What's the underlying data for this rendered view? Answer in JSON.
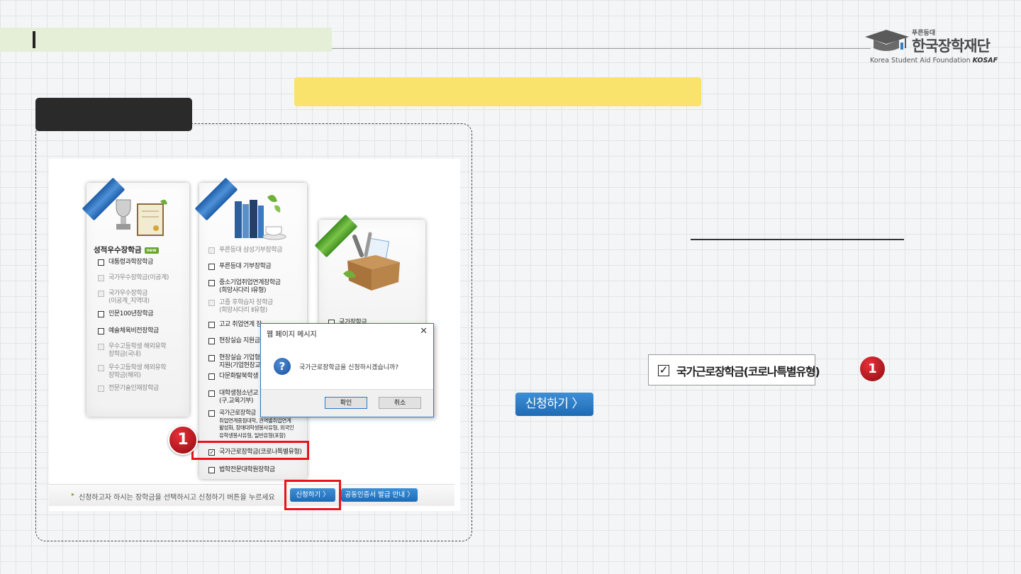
{
  "logo": {
    "small_text": "푸른등대",
    "main_text": "한국장학재단",
    "english_text": "Korea Student Aid Foundation",
    "english_abbr": "KOSAF"
  },
  "cards": {
    "card1": {
      "title": "성적우수장학금",
      "badge": "new",
      "items": [
        {
          "label": "대통령과학장학금",
          "enabled": true,
          "checked": false
        },
        {
          "label": "국가우수장학금(이공계)",
          "enabled": false,
          "checked": false
        },
        {
          "label": "국가우수장학금",
          "label2": "(이공계_지역대)",
          "enabled": false,
          "checked": false
        },
        {
          "label": "인문100년장학금",
          "enabled": true,
          "checked": false
        },
        {
          "label": "예술체육비전장학금",
          "enabled": true,
          "checked": false
        },
        {
          "label": "우수고등학생 해외유학",
          "label2": "장학금(국내)",
          "enabled": false,
          "checked": false
        },
        {
          "label": "우수고등학생 해외유학",
          "label2": "장학금(해외)",
          "enabled": false,
          "checked": false
        },
        {
          "label": "전문기술인재장학금",
          "enabled": false,
          "checked": false
        }
      ]
    },
    "card2": {
      "items": [
        {
          "label": "푸른등대 삼성기부장학금",
          "enabled": false,
          "checked": false
        },
        {
          "label": "푸른등대 기부장학금",
          "enabled": true,
          "checked": false
        },
        {
          "label": "중소기업취업연계장학금",
          "label2": "(희망사다리 Ⅰ유형)",
          "enabled": true,
          "checked": false
        },
        {
          "label": "고졸 후학습자 장학금",
          "label2": "(희망사다리 Ⅱ유형)",
          "enabled": false,
          "checked": false
        },
        {
          "label": "고교 취업연계 장",
          "enabled": true,
          "checked": false
        },
        {
          "label": "현장실습 지원금",
          "enabled": true,
          "checked": false
        },
        {
          "label": "현장실습 기업형",
          "label2": "지원(기업현장교",
          "enabled": true,
          "checked": false
        },
        {
          "label": "다문화탈북학생",
          "enabled": true,
          "checked": false
        },
        {
          "label": "대학생청소년교",
          "label2": "(구.교육기부)",
          "enabled": true,
          "checked": false
        },
        {
          "label": "국가근로장학금",
          "label2": "취업연계중점대학, 권역별취업연계",
          "label3": "활성화, 장애대학생봉사유형, 외국인",
          "label4": "유학생봉사유형, 일반유형(포함)",
          "enabled": true,
          "checked": false
        },
        {
          "label": "국가근로장학금(코로나특별유형)",
          "enabled": true,
          "checked": true
        },
        {
          "label": "법학전문대학원장학금",
          "enabled": true,
          "checked": false
        }
      ]
    },
    "card3": {
      "items": [
        {
          "label": "국가장학금",
          "enabled": true,
          "checked": false
        }
      ]
    }
  },
  "hint_text": "신청하고자 하시는 장학금을 선택하시고 신청하기 버튼을 누르세요",
  "apply_button_small": "신청하기 〉",
  "cert_button": "공동인증서 발급 안내 〉",
  "dialog": {
    "title": "웹 페이지 메시지",
    "close": "✕",
    "icon": "?",
    "message": "국가근로장학금을 신청하시겠습니까?",
    "ok_label": "확인",
    "cancel_label": "취소"
  },
  "step_badge": "1",
  "big_apply_button": "신청하기 〉",
  "zoom_item": {
    "label": "국가근로장학금(코로나특별유형)",
    "checkmark": "✓"
  },
  "colors": {
    "accent_red": "#e8141c",
    "button_blue": "#1e6bb4",
    "banner_yellow": "#f9e36c",
    "title_green": "#e5efd8"
  },
  "icons": {
    "dialog": "question-icon",
    "checkbox": "checkbox-icon",
    "logo": "graduation-cap-icon"
  }
}
